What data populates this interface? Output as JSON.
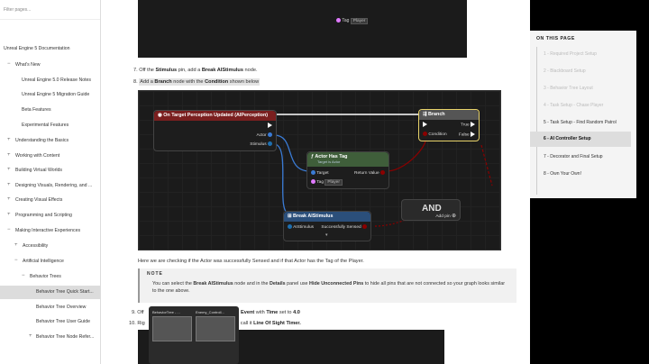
{
  "sidebar": {
    "filter_placeholder": "Filter pages...",
    "items": [
      {
        "label": "Unreal Engine 5 Documentation",
        "toggle": ""
      },
      {
        "label": "What's New",
        "toggle": "−"
      },
      {
        "label": "Unreal Engine 5.0 Release Notes",
        "toggle": ""
      },
      {
        "label": "Unreal Engine 5 Migration Guide",
        "toggle": ""
      },
      {
        "label": "Beta Features",
        "toggle": ""
      },
      {
        "label": "Experimental Features",
        "toggle": ""
      },
      {
        "label": "Understanding the Basics",
        "toggle": "+"
      },
      {
        "label": "Working with Content",
        "toggle": "+"
      },
      {
        "label": "Building Virtual Worlds",
        "toggle": "+"
      },
      {
        "label": "Designing Visuals, Rendering, and ...",
        "toggle": "+"
      },
      {
        "label": "Creating Visual Effects",
        "toggle": "+"
      },
      {
        "label": "Programming and Scripting",
        "toggle": "+"
      },
      {
        "label": "Making Interactive Experiences",
        "toggle": "−"
      },
      {
        "label": "Accessibility",
        "toggle": "+"
      },
      {
        "label": "Artificial Intelligence",
        "toggle": "−"
      },
      {
        "label": "Behavior Trees",
        "toggle": "−"
      },
      {
        "label": "Behavior Tree Quick Start...",
        "toggle": ""
      },
      {
        "label": "Behavior Tree Overview",
        "toggle": ""
      },
      {
        "label": "Behavior Tree User Guide",
        "toggle": ""
      },
      {
        "label": "Behavior Tree Node Refer...",
        "toggle": "+"
      }
    ]
  },
  "steps": {
    "s7_num": "7.",
    "s7_a": "Off the",
    "s7_b": "Stimulus",
    "s7_c": "pin, add a",
    "s7_d": "Break AIStimulus",
    "s7_e": "node.",
    "s8_num": "8.",
    "s8_a": "Add a",
    "s8_b": "Branch",
    "s8_c": "node with the",
    "s8_d": "Condition",
    "s8_e": "shown below",
    "caption": "Here we are checking if the Actor was successfully Sensed and if that Actor has the Tag of the Player.",
    "note_label": "NOTE",
    "note_a": "You can select the",
    "note_b": "Break AIStimulus",
    "note_c": "node and in the",
    "note_d": "Details",
    "note_e": "panel use",
    "note_f": "Hide Unconnected Pins",
    "note_g": "to hide all pins that are not connected so your graph looks similar",
    "note_line2": "to the one above.",
    "s9_num": "9.",
    "s9_a": "Off",
    "s9_b": "Event",
    "s9_c": "with",
    "s9_d": "Time",
    "s9_e": "set to",
    "s9_f": "4.0",
    "s10_num": "10.",
    "s10_a": "Rig",
    "s10_b": "nd call it",
    "s10_c": "Line Of Sight Timer."
  },
  "graph": {
    "top_tag_label": "Tag",
    "top_tag_value": "Player",
    "perception_title": "On Target Perception Updated (AIPerception)",
    "pin_actor": "Actor",
    "pin_stimulus": "Stimulus",
    "branch_title": "Branch",
    "pin_condition": "Condition",
    "pin_true": "True",
    "pin_false": "False",
    "hastag_title": "Actor Has Tag",
    "hastag_subtitle": "Target is Actor",
    "pin_target": "Target",
    "pin_return": "Return Value",
    "pin_tag": "Tag",
    "tag_value": "Player",
    "break_title": "Break AIStimulus",
    "pin_aistimulus": "AIStimulus",
    "pin_sensed": "Successfully Sensed",
    "and_title": "AND",
    "and_addpin": "Add pin"
  },
  "taskbar": {
    "thumb1": "BehaviorTree - ...",
    "thumb2": "Enemy_Controll..."
  },
  "toc": {
    "title": "ON THIS PAGE",
    "items": [
      {
        "label": "1 - Required Project Setup",
        "state": "past"
      },
      {
        "label": "2 - Blackboard Setup",
        "state": "past"
      },
      {
        "label": "3 - Behavior Tree Layout",
        "state": "past"
      },
      {
        "label": "4 - Task Setup - Chase Player",
        "state": "past"
      },
      {
        "label": "5 - Task Setup - Find Random Patrol",
        "state": "cur"
      },
      {
        "label": "6 - AI Controller Setup",
        "state": "active"
      },
      {
        "label": "7 - Decorator and Final Setup",
        "state": "cur"
      },
      {
        "label": "8 - Own Your Own!",
        "state": "cur"
      }
    ]
  },
  "colors": {
    "perception_head": "#7a1f1f",
    "branch_head": "#555555",
    "hastag_head": "#3f5e3a",
    "break_head": "#2b4f7a",
    "exec_wire": "#ffffff",
    "bool_wire": "#8b0000",
    "object_wire": "#3a7bd5"
  }
}
